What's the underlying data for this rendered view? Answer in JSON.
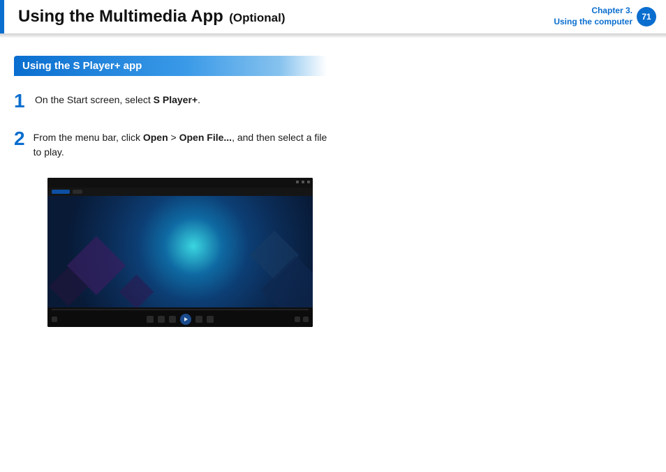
{
  "header": {
    "title": "Using the Multimedia App",
    "optional": "(Optional)",
    "chapter_line1": "Chapter 3.",
    "chapter_line2": "Using the computer",
    "page_number": "71"
  },
  "section": {
    "title": "Using the S Player+ app"
  },
  "steps": [
    {
      "num": "1",
      "pre": "On the Start screen, select ",
      "bold": "S Player+",
      "post": "."
    },
    {
      "num": "2",
      "pre": "From the menu bar, click ",
      "bold": "Open",
      "mid": " > ",
      "bold2": "Open File...",
      "post": ", and then select a file to play."
    }
  ]
}
